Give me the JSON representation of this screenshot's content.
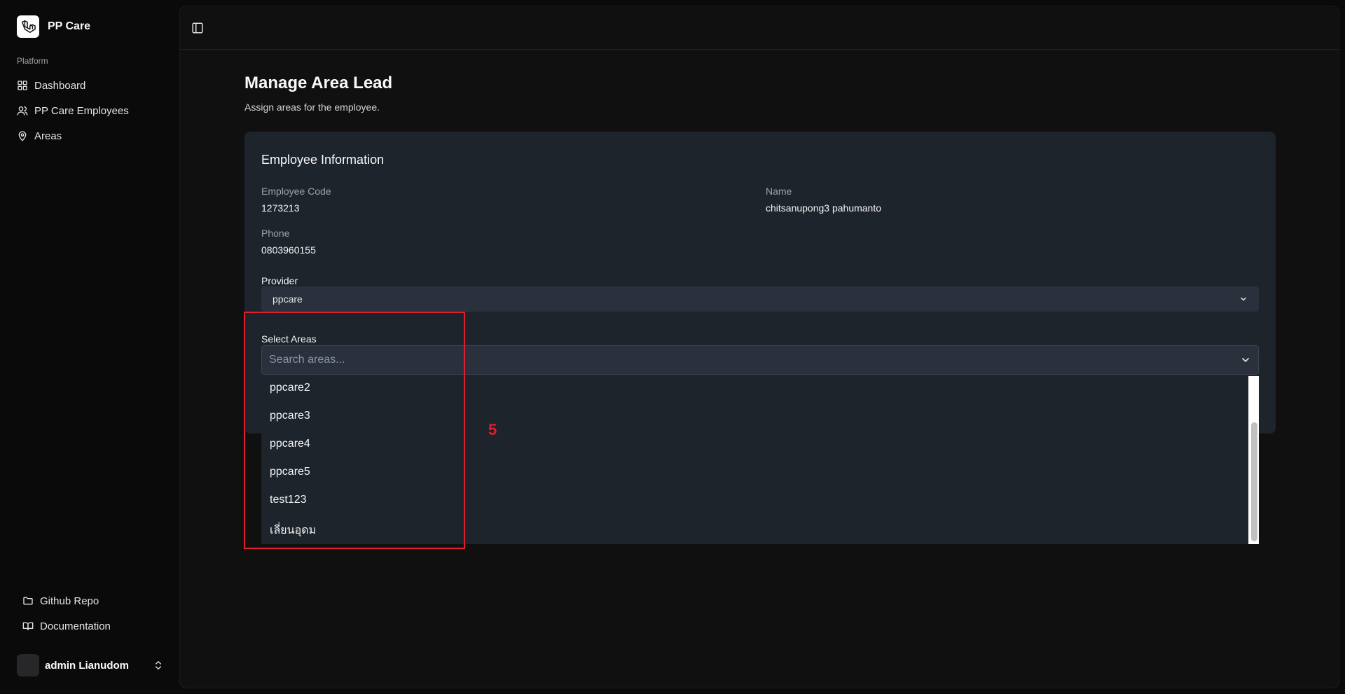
{
  "app": {
    "name": "PP Care"
  },
  "sidebar": {
    "group_label": "Platform",
    "items": [
      {
        "label": "Dashboard",
        "icon": "grid-icon"
      },
      {
        "label": "PP Care Employees",
        "icon": "users-icon"
      },
      {
        "label": "Areas",
        "icon": "map-pin-icon"
      }
    ],
    "bottom_items": [
      {
        "label": "Github Repo",
        "icon": "folder-icon"
      },
      {
        "label": "Documentation",
        "icon": "book-icon"
      }
    ],
    "user": {
      "name": "admin Lianudom"
    }
  },
  "page": {
    "title": "Manage Area Lead",
    "subtitle": "Assign areas for the employee."
  },
  "employee_card": {
    "title": "Employee Information",
    "fields": {
      "code_label": "Employee Code",
      "code_value": "1273213",
      "name_label": "Name",
      "name_value": "chitsanupong3 pahumanto",
      "phone_label": "Phone",
      "phone_value": "0803960155"
    },
    "provider": {
      "label": "Provider",
      "selected": "ppcare"
    },
    "areas": {
      "label": "Select Areas",
      "placeholder": "Search areas...",
      "options": [
        "ppcare2",
        "ppcare3",
        "ppcare4",
        "ppcare5",
        "test123",
        "เลี่ยนอุดม"
      ]
    }
  },
  "annotation": {
    "number": "5",
    "color": "#e11d2e"
  },
  "colors": {
    "background": "#0a0a0a",
    "card": "#1e242c",
    "input": "#2a313c"
  }
}
